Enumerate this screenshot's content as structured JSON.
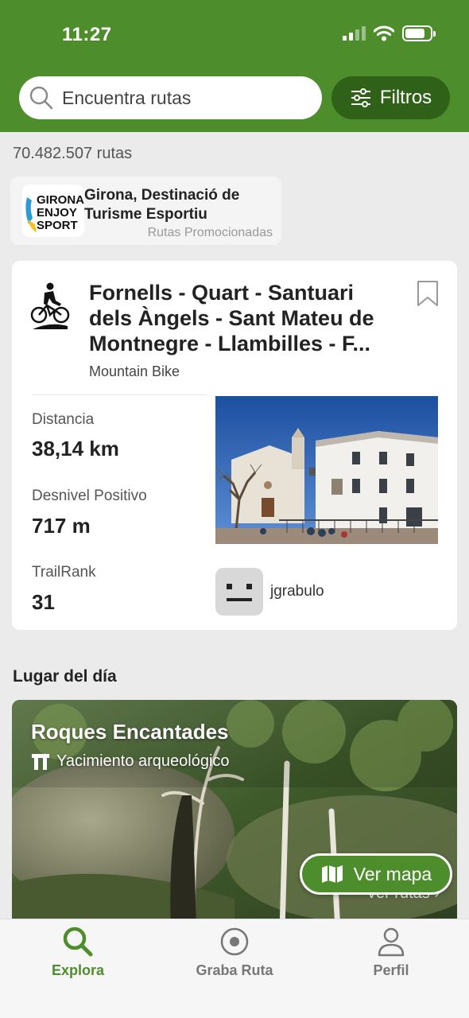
{
  "status_bar": {
    "time": "11:27"
  },
  "search": {
    "placeholder": "Encuentra rutas",
    "filters_label": "Filtros"
  },
  "route_count": "70.482.507 rutas",
  "promo": {
    "title": "Girona, Destinació de Turisme Esportiu",
    "subtitle": "Rutas Promocionadas",
    "logo_text": [
      "GIRONA",
      "ENJOY",
      "SPORT"
    ]
  },
  "route": {
    "title": "Fornells - Quart - Santuari\ndels Àngels - Sant Mateu de\nMontnegre - Llambilles - F...",
    "type": "Mountain Bike",
    "stats": [
      {
        "label": "Distancia",
        "value": "38,14 km"
      },
      {
        "label": "Desnivel Positivo",
        "value": "717 m"
      },
      {
        "label": "TrailRank",
        "value": "31"
      }
    ],
    "user": "jgrabulo",
    "activity_icon": "mountain-bike-icon"
  },
  "place_of_day": {
    "section_title": "Lugar del día",
    "name": "Roques Encantades",
    "type": "Yacimiento arqueológico",
    "see_routes": "Ver rutas",
    "map_button": "Ver mapa"
  },
  "tabs": [
    {
      "label": "Explora",
      "icon": "search-icon",
      "active": true
    },
    {
      "label": "Graba Ruta",
      "icon": "record-icon",
      "active": false
    },
    {
      "label": "Perfil",
      "icon": "user-icon",
      "active": false
    }
  ],
  "colors": {
    "brand_green": "#4e8d2c",
    "dark_green": "#2f6118"
  }
}
